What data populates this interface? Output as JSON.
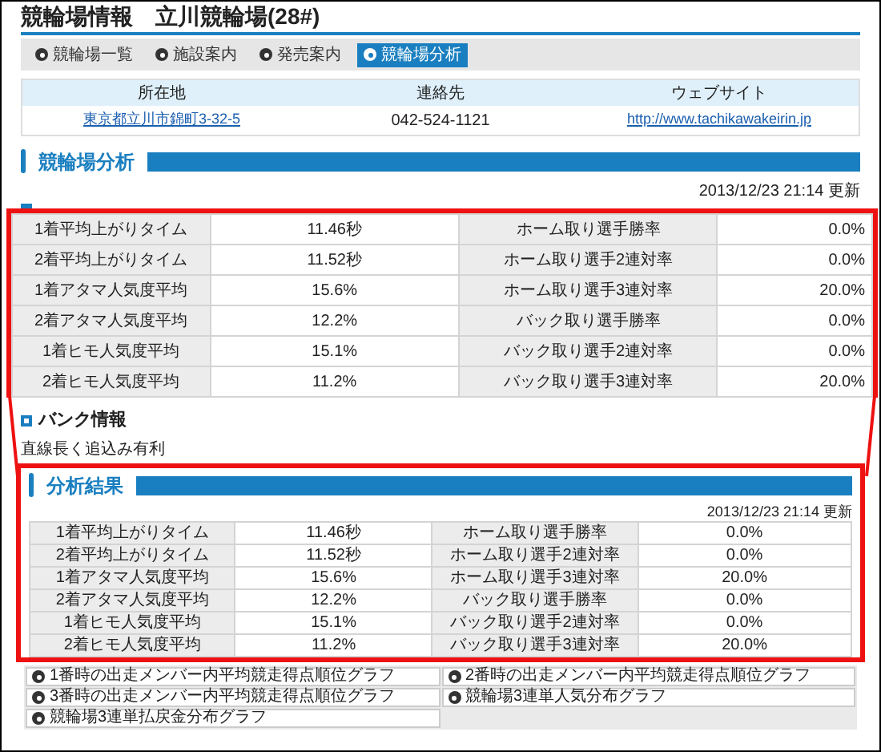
{
  "page_title": "競輪場情報　立川競輪場(28#)",
  "tabs": [
    {
      "label": "競輪場一覧",
      "selected": false
    },
    {
      "label": "施設案内",
      "selected": false
    },
    {
      "label": "発売案内",
      "selected": false
    },
    {
      "label": "競輪場分析",
      "selected": true
    }
  ],
  "info_table": {
    "columns": [
      "所在地",
      "連絡先",
      "ウェブサイト"
    ],
    "row": [
      {
        "text": "東京都立川市錦町3-32-5",
        "kind": "link"
      },
      {
        "text": "042-524-1121",
        "kind": "text"
      },
      {
        "text": "http://www.tachikawakeirin.jp",
        "kind": "link"
      }
    ]
  },
  "analysis_section": {
    "title": "競輪場分析",
    "updated": "2013/12/23 21:14 更新"
  },
  "bank_info": {
    "heading": "バンク情報",
    "text": "直線長く追込み有利"
  },
  "callout_rows": [
    {
      "label": "1着平均上がりタイム",
      "value": "11.46秒",
      "label_2": "ホーム取り選手勝率",
      "value_2": "0.0%"
    },
    {
      "label": "2着平均上がりタイム",
      "value": "11.52秒",
      "label_2": "ホーム取り選手2連対率",
      "value_2": "0.0%"
    },
    {
      "label": "1着アタマ人気度平均",
      "value": "15.6%",
      "label_2": "ホーム取り選手3連対率",
      "value_2": "20.0%"
    },
    {
      "label": "2着アタマ人気度平均",
      "value": "12.2%",
      "label_2": "バック取り選手勝率",
      "value_2": "0.0%"
    },
    {
      "label": "1着ヒモ人気度平均",
      "value": "15.1%",
      "label_2": "バック取り選手2連対率",
      "value_2": "0.0%"
    },
    {
      "label": "2着ヒモ人気度平均",
      "value": "11.2%",
      "label_2": "バック取り選手3連対率",
      "value_2": "20.0%"
    }
  ],
  "results_section": {
    "title": "分析結果",
    "updated": "2013/12/23 21:14 更新",
    "rows": [
      {
        "label": "1着平均上がりタイム",
        "value": "11.46秒",
        "label_2": "ホーム取り選手勝率",
        "value_2": "0.0%"
      },
      {
        "label": "2着平均上がりタイム",
        "value": "11.52秒",
        "label_2": "ホーム取り選手2連対率",
        "value_2": "0.0%"
      },
      {
        "label": "1着アタマ人気度平均",
        "value": "15.6%",
        "label_2": "ホーム取り選手3連対率",
        "value_2": "20.0%"
      },
      {
        "label": "2着アタマ人気度平均",
        "value": "12.2%",
        "label_2": "バック取り選手勝率",
        "value_2": "0.0%"
      },
      {
        "label": "1着ヒモ人気度平均",
        "value": "15.1%",
        "label_2": "バック取り選手2連対率",
        "value_2": "0.0%"
      },
      {
        "label": "2着ヒモ人気度平均",
        "value": "11.2%",
        "label_2": "バック取り選手3連対率",
        "value_2": "20.0%"
      }
    ]
  },
  "graph_buttons": [
    "1番時の出走メンバー内平均競走得点順位グラフ",
    "2番時の出走メンバー内平均競走得点順位グラフ",
    "3番時の出走メンバー内平均競走得点順位グラフ",
    "競輪場3連単人気分布グラフ",
    "競輪場3連単払戻金分布グラフ"
  ]
}
